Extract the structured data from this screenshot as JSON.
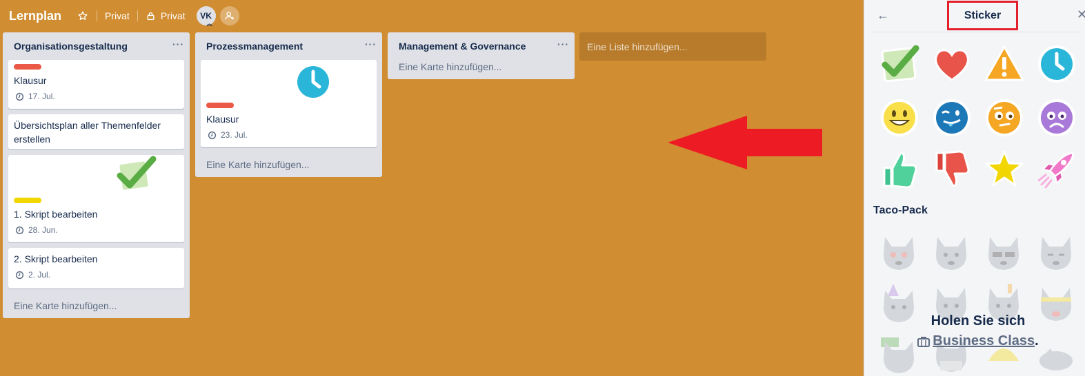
{
  "header": {
    "board_title": "Lernplan",
    "visibility_label": "Privat",
    "team_label": "Privat",
    "avatar_initials": "VK",
    "star_icon": "star-outline-icon",
    "lock_icon": "lock-icon",
    "add_member_icon": "add-member-icon"
  },
  "lists": [
    {
      "title": "Organisationsgestaltung",
      "menu": "···",
      "add_card": "Eine Karte hinzufügen...",
      "cards": [
        {
          "label_color": "#eb5a46",
          "title": "Klausur",
          "due": "17. Jul."
        },
        {
          "title": "Übersichtsplan aller Themenfelder erstellen"
        },
        {
          "sticker": "check-sticker",
          "label_color": "#f2d600",
          "title": "1. Skript bearbeiten",
          "due": "28. Jun."
        },
        {
          "title": "2. Skript bearbeiten",
          "due": "2. Jul."
        }
      ]
    },
    {
      "title": "Prozessmanagement",
      "menu": "···",
      "add_card": "Eine Karte hinzufügen...",
      "cards": [
        {
          "sticker": "clock-sticker",
          "label_color": "#eb5a46",
          "title": "Klausur",
          "due": "23. Jul."
        }
      ]
    },
    {
      "title": "Management & Governance",
      "menu": "···",
      "add_card": "Eine Karte hinzufügen...",
      "cards": []
    }
  ],
  "add_list": "Eine Liste hinzufügen...",
  "annotation": {
    "arrow_color": "#ed1c24"
  },
  "sidebar": {
    "title": "Sticker",
    "back_icon": "←",
    "close_icon": "✕",
    "stickers": [
      "check",
      "heart",
      "warning",
      "clock",
      "smile",
      "wink-tongue",
      "eyebrow",
      "frown",
      "thumbs-up",
      "thumbs-down",
      "star",
      "rocket"
    ],
    "pack_title": "Taco-Pack",
    "upsell_line1": "Holen Sie sich",
    "upsell_link": "Business Class",
    "upsell_period": "."
  },
  "colors": {
    "board_bg": "#d18d31",
    "list_bg": "#dfe1e6",
    "label_red": "#eb5a46",
    "label_yellow": "#f2d600",
    "highlight_box": "#e3202a"
  }
}
